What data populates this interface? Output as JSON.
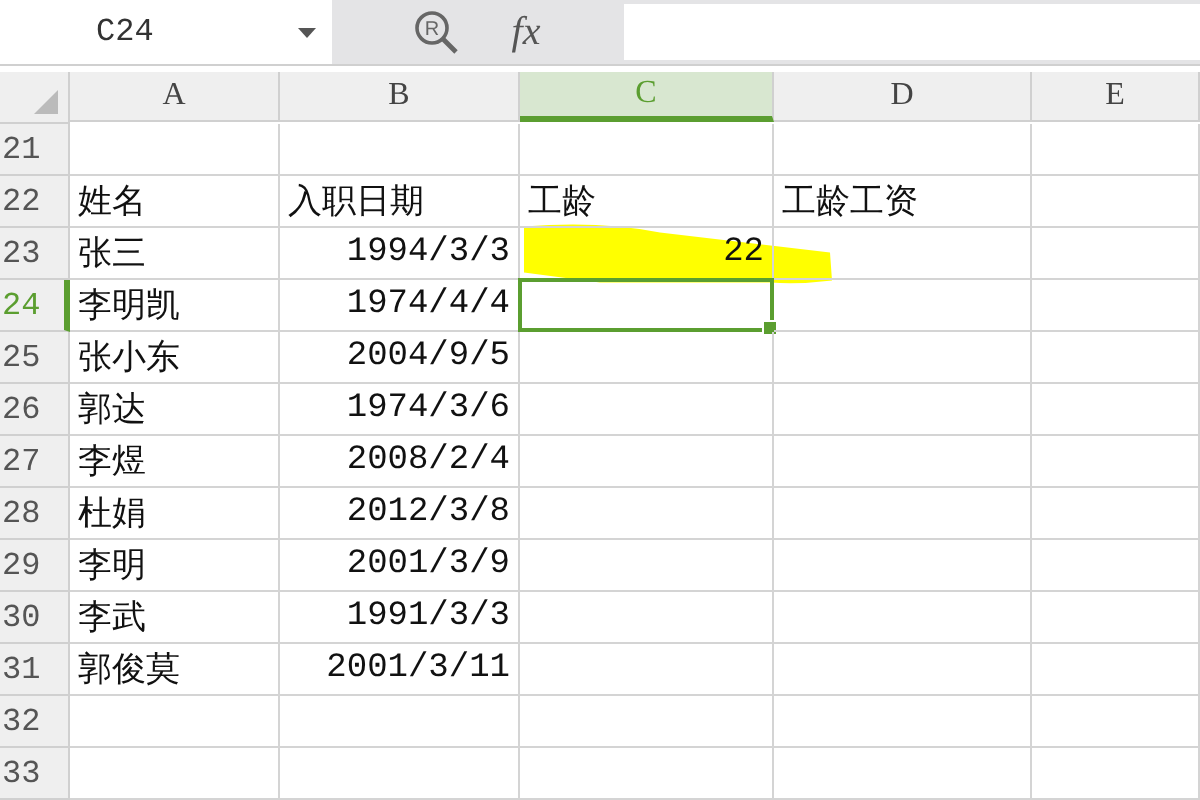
{
  "formula_bar": {
    "name_box": "C24",
    "search_mark": "R",
    "function_label": "fx"
  },
  "columns": [
    {
      "label": "A",
      "selected": false
    },
    {
      "label": "B",
      "selected": false
    },
    {
      "label": "C",
      "selected": true
    },
    {
      "label": "D",
      "selected": false
    },
    {
      "label": "E",
      "selected": false
    }
  ],
  "rows": [
    {
      "number": "21",
      "selected": false,
      "cells": {}
    },
    {
      "number": "22",
      "selected": false,
      "cells": {
        "A": {
          "text": "姓名",
          "kind": "text"
        },
        "B": {
          "text": "入职日期",
          "kind": "text"
        },
        "C": {
          "text": "工龄",
          "kind": "text"
        },
        "D": {
          "text": "工龄工资",
          "kind": "text"
        }
      }
    },
    {
      "number": "23",
      "selected": false,
      "cells": {
        "A": {
          "text": "张三",
          "kind": "text"
        },
        "B": {
          "text": "1994/3/3",
          "kind": "number"
        },
        "C": {
          "text": "22",
          "kind": "number"
        }
      }
    },
    {
      "number": "24",
      "selected": true,
      "cells": {
        "A": {
          "text": "李明凯",
          "kind": "text"
        },
        "B": {
          "text": "1974/4/4",
          "kind": "number"
        }
      }
    },
    {
      "number": "25",
      "selected": false,
      "cells": {
        "A": {
          "text": "张小东",
          "kind": "text"
        },
        "B": {
          "text": "2004/9/5",
          "kind": "number"
        }
      }
    },
    {
      "number": "26",
      "selected": false,
      "cells": {
        "A": {
          "text": "郭达",
          "kind": "text"
        },
        "B": {
          "text": "1974/3/6",
          "kind": "number"
        }
      }
    },
    {
      "number": "27",
      "selected": false,
      "cells": {
        "A": {
          "text": "李煜",
          "kind": "text"
        },
        "B": {
          "text": "2008/2/4",
          "kind": "number"
        }
      }
    },
    {
      "number": "28",
      "selected": false,
      "cells": {
        "A": {
          "text": "杜娟",
          "kind": "text"
        },
        "B": {
          "text": "2012/3/8",
          "kind": "number"
        }
      }
    },
    {
      "number": "29",
      "selected": false,
      "cells": {
        "A": {
          "text": "李明",
          "kind": "text"
        },
        "B": {
          "text": "2001/3/9",
          "kind": "number"
        }
      }
    },
    {
      "number": "30",
      "selected": false,
      "cells": {
        "A": {
          "text": "李武",
          "kind": "text"
        },
        "B": {
          "text": "1991/3/3",
          "kind": "number"
        }
      }
    },
    {
      "number": "31",
      "selected": false,
      "cells": {
        "A": {
          "text": "郭俊莫",
          "kind": "text"
        },
        "B": {
          "text": "2001/3/11",
          "kind": "number"
        }
      }
    },
    {
      "number": "32",
      "selected": false,
      "cells": {}
    },
    {
      "number": "33",
      "selected": false,
      "cells": {}
    }
  ]
}
